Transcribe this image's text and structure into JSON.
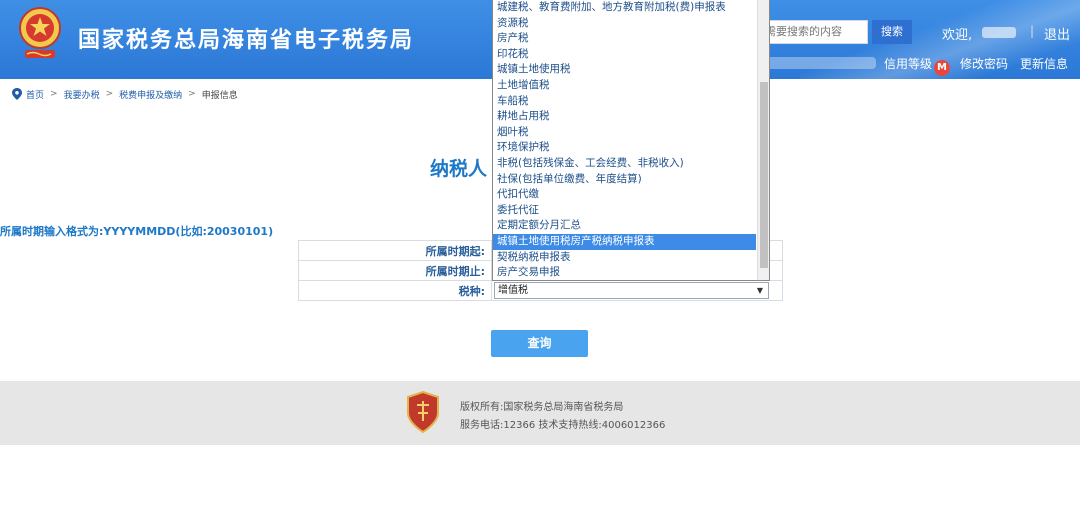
{
  "header": {
    "site_title": "国家税务总局海南省电子税务局",
    "search_placeholder": "需要搜索的内容",
    "search_button": "搜索",
    "welcome": "欢迎,",
    "separator": "|",
    "logout": "退出",
    "credit_level": "信用等级",
    "credit_badge": "M",
    "change_password": "修改密码",
    "update_info": "更新信息"
  },
  "breadcrumb": {
    "items": [
      "首页",
      "我要办税",
      "税费申报及缴纳"
    ],
    "separator": ">",
    "current": "申报信息"
  },
  "form": {
    "title": "纳税人",
    "format_hint": "所属时期输入格式为:YYYYMMDD(比如:20030101)",
    "period_start_label": "所属时期起:",
    "period_end_label": "所属时期止:",
    "tax_type_label": "税种:",
    "tax_type_selected": "增值税",
    "caret": "▼",
    "query_button": "查询"
  },
  "dropdown": {
    "options": [
      "城建税、教育费附加、地方教育附加税(费)申报表",
      "资源税",
      "房产税",
      "印花税",
      "城镇土地使用税",
      "土地增值税",
      "车船税",
      "耕地占用税",
      "烟叶税",
      "环境保护税",
      "非税(包括残保金、工会经费、非税收入)",
      "社保(包括单位缴费、年度结算)",
      "代扣代缴",
      "委托代征",
      "定期定额分月汇总",
      "城镇土地使用税房产税纳税申报表",
      "契税纳税申报表",
      "房产交易申报"
    ],
    "highlighted_index": 15
  },
  "footer": {
    "line1": "版权所有:国家税务总局海南省税务局",
    "line2": "服务电话:12366 技术支持热线:4006012366"
  },
  "colors": {
    "header_blue": "#2b78d6",
    "accent_blue": "#1e78c8",
    "selected_option": "#3d8be7",
    "query_button": "#4aa3ee",
    "credit_badge": "#e8483b"
  }
}
